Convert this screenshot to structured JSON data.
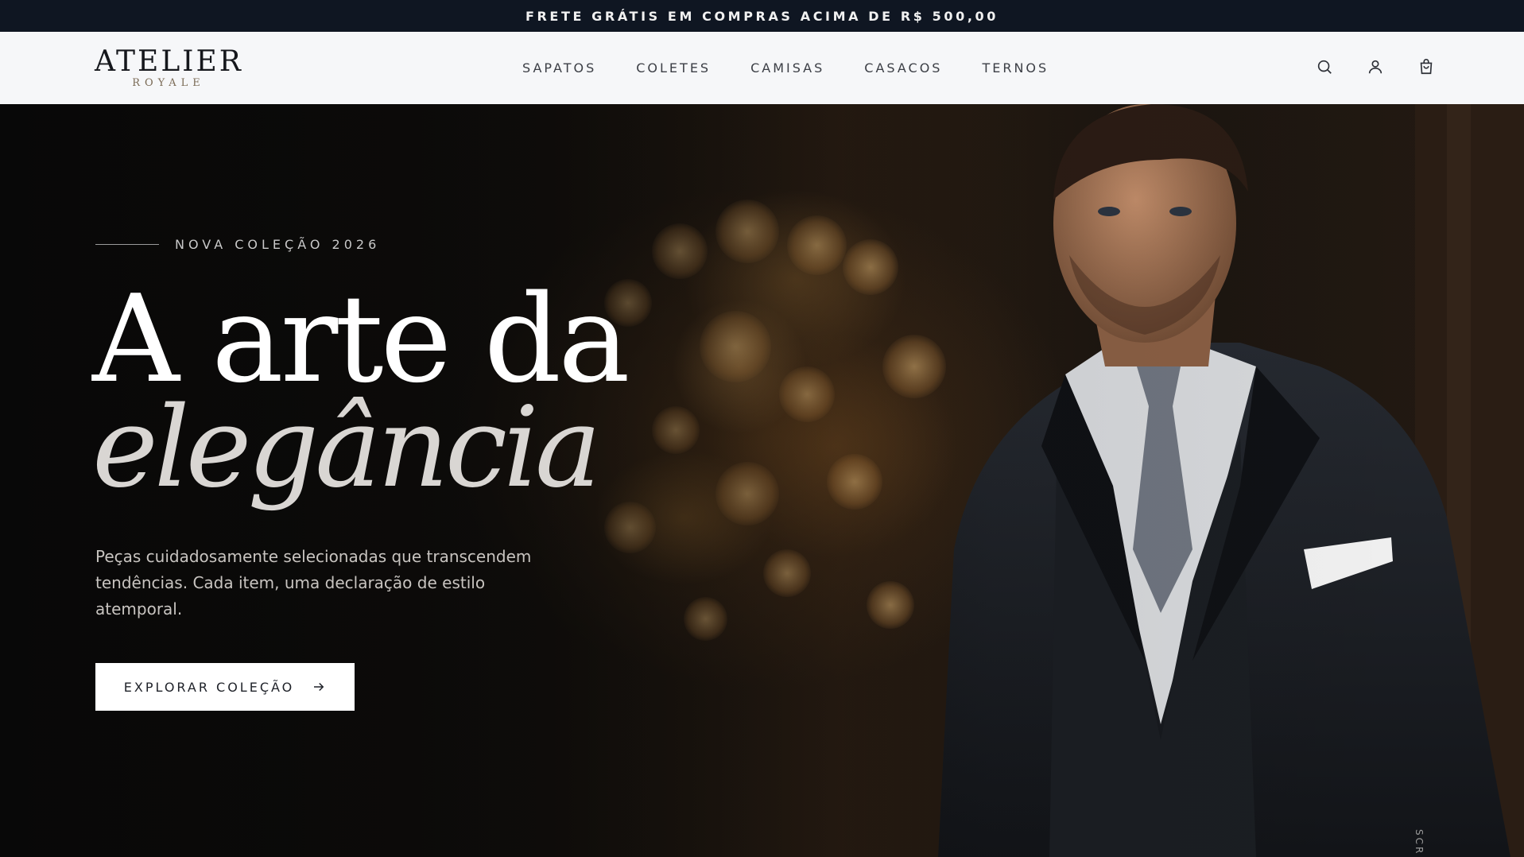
{
  "announcement": {
    "text": "FRETE GRÁTIS EM COMPRAS ACIMA DE R$ 500,00"
  },
  "brand": {
    "name": "ATELIER",
    "tagline": "ROYALE"
  },
  "nav": {
    "items": [
      {
        "label": "SAPATOS"
      },
      {
        "label": "COLETES"
      },
      {
        "label": "CAMISAS"
      },
      {
        "label": "CASACOS"
      },
      {
        "label": "TERNOS"
      }
    ]
  },
  "header_icons": [
    "search-icon",
    "user-icon",
    "cart-icon"
  ],
  "hero": {
    "eyebrow": "NOVA COLEÇÃO 2026",
    "headline_line1": "A arte da",
    "headline_line2": "elegância",
    "description": "Peças cuidadosamente selecionadas que transcendem tendências. Cada item, uma declaração de estilo atemporal.",
    "cta_label": "EXPLORAR COLEÇÃO",
    "scroll_hint": "SCR"
  },
  "colors": {
    "topbar_bg": "#0f1622",
    "header_bg": "#f6f7f9",
    "cta_bg": "#ffffff",
    "headline": "#ffffff"
  }
}
